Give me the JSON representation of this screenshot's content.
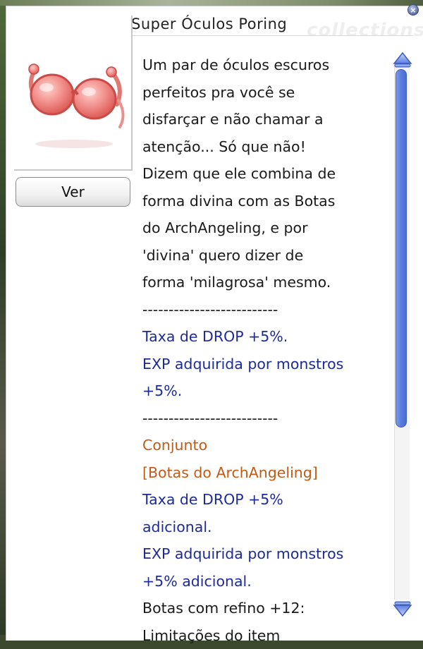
{
  "window": {
    "title": "Super Óculos Poring",
    "watermark": "collections"
  },
  "close_icon": "close-icon",
  "view_button": {
    "label": "Ver"
  },
  "description": [
    {
      "text": "Um par de óculos escuros",
      "style": "normal"
    },
    {
      "text": "perfeitos pra você se",
      "style": "normal"
    },
    {
      "text": "disfarçar e não chamar a",
      "style": "normal"
    },
    {
      "text": "atenção... Só que não!",
      "style": "normal"
    },
    {
      "text": "Dizem que ele combina de",
      "style": "normal"
    },
    {
      "text": "forma divina com as Botas",
      "style": "normal"
    },
    {
      "text": "do ArchAngeling, e por",
      "style": "normal"
    },
    {
      "text": "'divina' quero dizer de",
      "style": "normal"
    },
    {
      "text": "forma 'milagrosa' mesmo.",
      "style": "normal"
    },
    {
      "text": "--------------------------",
      "style": "normal"
    },
    {
      "text": "Taxa de DROP +5%.",
      "style": "blue"
    },
    {
      "text": "EXP adquirida por monstros",
      "style": "blue"
    },
    {
      "text": "+5%.",
      "style": "blue"
    },
    {
      "text": "--------------------------",
      "style": "normal"
    },
    {
      "text": "Conjunto",
      "style": "orange"
    },
    {
      "text": "[Botas do ArchAngeling]",
      "style": "orange"
    },
    {
      "text": "Taxa de DROP +5%",
      "style": "blue"
    },
    {
      "text": "adicional.",
      "style": "blue"
    },
    {
      "text": "EXP adquirida por monstros",
      "style": "blue"
    },
    {
      "text": "+5% adicional.",
      "style": "blue"
    },
    {
      "text": "Botas com refino +12:",
      "style": "normal"
    },
    {
      "text": "Limitações do item",
      "style": "normal"
    }
  ],
  "colors": {
    "blue_text": "#1c2a9a",
    "orange_text": "#c25a17",
    "scrollbar": "#5a7fe0"
  }
}
